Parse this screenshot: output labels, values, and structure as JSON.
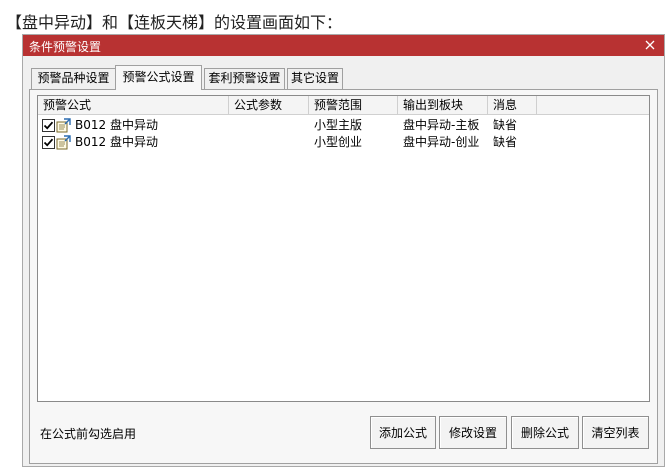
{
  "caption": "【盘中异动】和【连板天梯】的设置画面如下：",
  "dialog": {
    "title": "条件预警设置",
    "tabs": [
      {
        "label": "预警品种设置"
      },
      {
        "label": "预警公式设置"
      },
      {
        "label": "套利预警设置"
      },
      {
        "label": "其它设置"
      }
    ],
    "active_tab": "预警公式设置",
    "columns": [
      "预警公式",
      "公式参数",
      "预警范围",
      "输出到板块",
      "消息"
    ],
    "rows": [
      {
        "checked": true,
        "formula": "B012 盘中异动",
        "params": "",
        "scope": "小型主版",
        "output": "盘中异动-主板",
        "message": "缺省"
      },
      {
        "checked": true,
        "formula": "B012 盘中异动",
        "params": "",
        "scope": "小型创业",
        "output": "盘中异动-创业",
        "message": "缺省"
      }
    ],
    "hint": "在公式前勾选启用",
    "buttons": {
      "add": "添加公式",
      "modify": "修改设置",
      "delete": "删除公式",
      "clear": "清空列表"
    }
  },
  "colors": {
    "titlebar": "#b83232",
    "dialog_bg": "#f0f0f0",
    "list_bg": "#ffffff"
  }
}
